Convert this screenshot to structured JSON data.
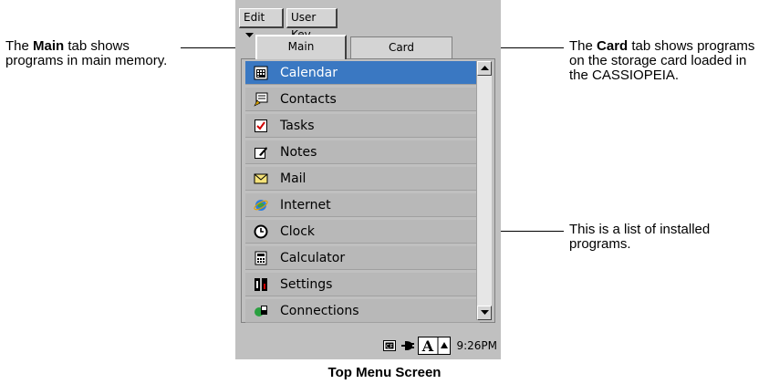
{
  "callouts": {
    "main": {
      "bold": "Main",
      "pre": "The ",
      "post": " tab shows programs in main memory."
    },
    "card": {
      "bold": "Card",
      "pre": "The ",
      "post": " tab shows programs on the storage card loaded in the CASSIOPEIA."
    },
    "list": {
      "text": "This is a list of installed programs."
    }
  },
  "menubar": {
    "edit_label": "Edit",
    "userkey_label": "User Key"
  },
  "tabs": {
    "main": "Main",
    "card": "Card"
  },
  "programs": [
    {
      "label": "Calendar",
      "icon": "calendar-icon",
      "selected": true
    },
    {
      "label": "Contacts",
      "icon": "contacts-icon"
    },
    {
      "label": "Tasks",
      "icon": "tasks-icon"
    },
    {
      "label": "Notes",
      "icon": "notes-icon"
    },
    {
      "label": "Mail",
      "icon": "mail-icon"
    },
    {
      "label": "Internet",
      "icon": "internet-icon"
    },
    {
      "label": "Clock",
      "icon": "clock-icon"
    },
    {
      "label": "Calculator",
      "icon": "calculator-icon"
    },
    {
      "label": "Settings",
      "icon": "settings-icon"
    },
    {
      "label": "Connections",
      "icon": "connections-icon"
    }
  ],
  "status": {
    "time": "9:26PM",
    "input_glyph": "A"
  },
  "caption": "Top Menu Screen",
  "colors": {
    "selection": "#3a78c2",
    "device_bg": "#c0c0c0"
  }
}
